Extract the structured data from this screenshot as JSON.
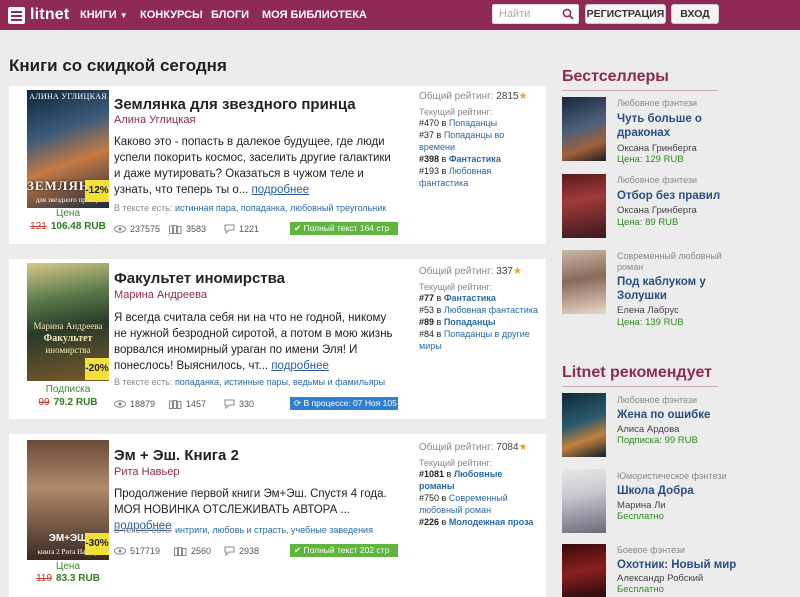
{
  "header": {
    "logo_text": "litnet",
    "nav": [
      {
        "label": "КНИГИ"
      },
      {
        "label": "КОНКУРСЫ"
      },
      {
        "label": "БЛОГИ"
      },
      {
        "label": "МОЯ БИБЛИОТЕКА"
      }
    ],
    "search_placeholder": "Найти",
    "register_label": "РЕГИСТРАЦИЯ",
    "login_label": "ВХОД"
  },
  "main": {
    "title": "Книги со скидкой сегодня",
    "books": [
      {
        "cover_top": "АЛИНА УГЛИЦКАЯ",
        "cover_big": "ЗЕМЛЯНКА",
        "cover_sub": "для звездного принца",
        "discount": "-12%",
        "price_label": "Цена",
        "old_price": "121",
        "price": "106.48 RUB",
        "title": "Землянка для звездного принца",
        "author": "Алина Углицкая",
        "description": "Каково это - попасть в далекое будущее, где люди успели покорить космос, заселить другие галактики и даже мутировать? Оказаться в чужом теле и узнать, что теперь ты о...",
        "more": "подробнее",
        "tags_prefix": "В тексте есть:",
        "tags": "истинная пара, попаданка, любовный треугольник",
        "views": "237575",
        "library": "3583",
        "comments": "1221",
        "status": "✔ Полный текст   164 стр",
        "rating_label": "Общий рейтинг:",
        "rating": "2815",
        "current_label": "Текущий рейтинг:",
        "ranks": [
          {
            "num": "#470",
            "in": " в ",
            "cat": "Попаданцы"
          },
          {
            "num": "#37",
            "in": " в ",
            "cat": "Попаданцы во времени"
          },
          {
            "num": "#398",
            "in": " в ",
            "cat": "Фантастика"
          },
          {
            "num": "#193",
            "in": " в ",
            "cat": "Любовная фантастика"
          }
        ]
      },
      {
        "cover_top": "Марина Андреева",
        "cover_big": "Факультет",
        "cover_sub": "иномирства",
        "discount": "-20%",
        "price_label": "Подписка",
        "old_price": "99",
        "price": "79.2 RUB",
        "title": "Факультет иномирства",
        "author": "Марина Андреева",
        "description": "Я всегда считала себя ни на что не годной, никому не нужной безродной сиротой, а потом в мою жизнь ворвался иномирный ураган по имени Эля! И понеслось! Выяснилось, чт...",
        "more": "подробнее",
        "tags_prefix": "В тексте есть:",
        "tags": "попаданка, истинные пары, ведьмы и фамильяры",
        "views": "18879",
        "library": "1457",
        "comments": "330",
        "status": "⟳ В процессе: 07 Ноя    105 стр",
        "rating_label": "Общий рейтинг:",
        "rating": "337",
        "current_label": "Текущий рейтинг:",
        "ranks": [
          {
            "num": "#77",
            "in": " в ",
            "cat": "Фантастика"
          },
          {
            "num": "#53",
            "in": " в ",
            "cat": "Любовная фантастика"
          },
          {
            "num": "#89",
            "in": " в ",
            "cat": "Попаданцы"
          },
          {
            "num": "#84",
            "in": " в ",
            "cat": "Попаданцы в другие миры"
          }
        ]
      },
      {
        "cover_top": "",
        "cover_big": "ЭМ+ЭШ",
        "cover_sub": "книга 2  Рита Навьер",
        "discount": "-30%",
        "price_label": "Цена",
        "old_price": "119",
        "price": "83.3 RUB",
        "title": "Эм + Эш. Книга 2",
        "author": "Рита Навьер",
        "description": "Продолжение первой книги Эм+Эш. Спустя 4 года. МОЯ НОВИНКА ОТСЛЕЖИВАТЬ АВТОРА ...",
        "more": "подробнее",
        "tags_prefix": "В тексте есть:",
        "tags": "интриги, любовь и страсть, учебные заведения",
        "views": "517719",
        "library": "2560",
        "comments": "2938",
        "status": "✔ Полный текст   202 стр",
        "rating_label": "Общий рейтинг:",
        "rating": "7084",
        "current_label": "Текущий рейтинг:",
        "ranks": [
          {
            "num": "#1081",
            "in": " в ",
            "cat": "Любовные романы"
          },
          {
            "num": "#750",
            "in": " в ",
            "cat": "Современный любовный роман"
          },
          {
            "num": "#226",
            "in": " в ",
            "cat": "Молодежная проза"
          }
        ]
      }
    ]
  },
  "sidebar": {
    "bestsellers_title": "Бестселлеры",
    "bestsellers": [
      {
        "genre": "Любовное фэнтези",
        "title": "Чуть больше о драконах",
        "author": "Оксана Гринберга",
        "price": "Цена: 129 RUB"
      },
      {
        "genre": "Любовное фэнтези",
        "title": "Отбор без правил",
        "author": "Оксана Гринберга",
        "price": "Цена: 89 RUB"
      },
      {
        "genre": "Современный любовный роман",
        "title": "Под каблуком у Золушки",
        "author": "Елена Лабрус",
        "price": "Цена: 139 RUB"
      }
    ],
    "recommends_title": "Litnet рекомендует",
    "recommends": [
      {
        "genre": "Любовное фэнтези",
        "title": "Жена по ошибке",
        "author": "Алиса Ардова",
        "price": "Подписка: 99 RUB"
      },
      {
        "genre": "Юмористическое фэнтези",
        "title": "Школа Добра",
        "author": "Марина Ли",
        "price": "Бесплатно"
      },
      {
        "genre": "Боевое фэнтези",
        "title": "Охотник: Новый мир",
        "author": "Александр Робский",
        "price": "Бесплатно"
      }
    ]
  },
  "colors": {
    "brand": "#8e2a55",
    "link": "#2a6aa8",
    "price": "#2e7d1f",
    "discount": "#f3e03b"
  }
}
